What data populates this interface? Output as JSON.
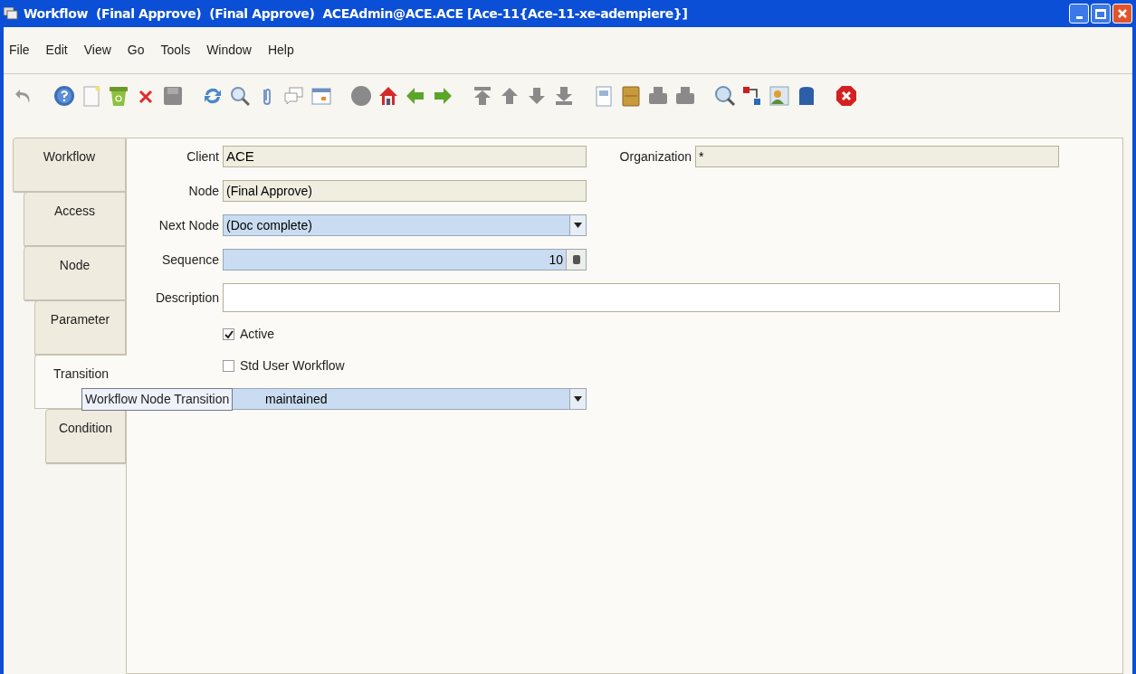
{
  "window": {
    "title": "Workflow  (Final Approve)  (Final Approve)  ACEAdmin@ACE.ACE [Ace-11{Ace-11-xe-adempiere}]"
  },
  "menu": [
    "File",
    "Edit",
    "View",
    "Go",
    "Tools",
    "Window",
    "Help"
  ],
  "tabs": [
    {
      "label": "Workflow",
      "selected": false
    },
    {
      "label": "Access",
      "selected": false
    },
    {
      "label": "Node",
      "selected": false
    },
    {
      "label": "Parameter",
      "selected": false
    },
    {
      "label": "Transition",
      "selected": true
    },
    {
      "label": "Condition",
      "selected": false
    }
  ],
  "form": {
    "client": {
      "label": "Client",
      "value": "ACE"
    },
    "organization": {
      "label": "Organization",
      "value": "*"
    },
    "node": {
      "label": "Node",
      "value": "(Final Approve)"
    },
    "next_node": {
      "label": "Next Node",
      "value": "(Doc complete)"
    },
    "sequence": {
      "label": "Sequence",
      "value": "10"
    },
    "description": {
      "label": "Description"
    },
    "checkboxes": [
      {
        "label": "Active",
        "checked": true
      },
      {
        "label": "Std User Workflow",
        "checked": false
      }
    ],
    "entity_type": {
      "value": "maintained"
    }
  },
  "tooltip": "Workflow Node Transition"
}
